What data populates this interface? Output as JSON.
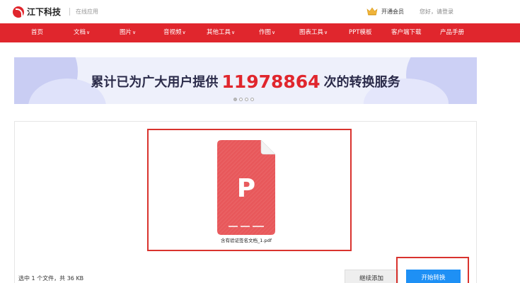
{
  "header": {
    "logo_text": "江下科技",
    "subtitle": "在线应用",
    "vip_label": "开通会员",
    "greeting": "您好，请登录"
  },
  "nav": {
    "items": [
      {
        "label": "首页",
        "has_caret": false
      },
      {
        "label": "文档",
        "has_caret": true
      },
      {
        "label": "图片",
        "has_caret": true
      },
      {
        "label": "音视频",
        "has_caret": true
      },
      {
        "label": "其他工具",
        "has_caret": true
      },
      {
        "label": "作图",
        "has_caret": true
      },
      {
        "label": "图表工具",
        "has_caret": true
      },
      {
        "label": "PPT模板",
        "has_caret": false
      },
      {
        "label": "客户端下载",
        "has_caret": false
      },
      {
        "label": "产品手册",
        "has_caret": false
      }
    ],
    "caret_glyph": "∨"
  },
  "banner": {
    "prefix": "累计已为广大用户提供",
    "count": "11978864",
    "suffix": "次的转换服务",
    "carousel_total": 4,
    "carousel_active": 1
  },
  "file": {
    "type_letter": "P",
    "name": "含有验证签名文档_1.pdf"
  },
  "footer": {
    "status": "选中 1 个文件，共 36 KB",
    "continue_label": "继续添加",
    "start_label": "开始转换"
  },
  "colors": {
    "brand_red": "#e0262d",
    "file_icon": "#e8585b",
    "start_blue": "#1e90f5",
    "highlight_border": "#d9332e"
  }
}
